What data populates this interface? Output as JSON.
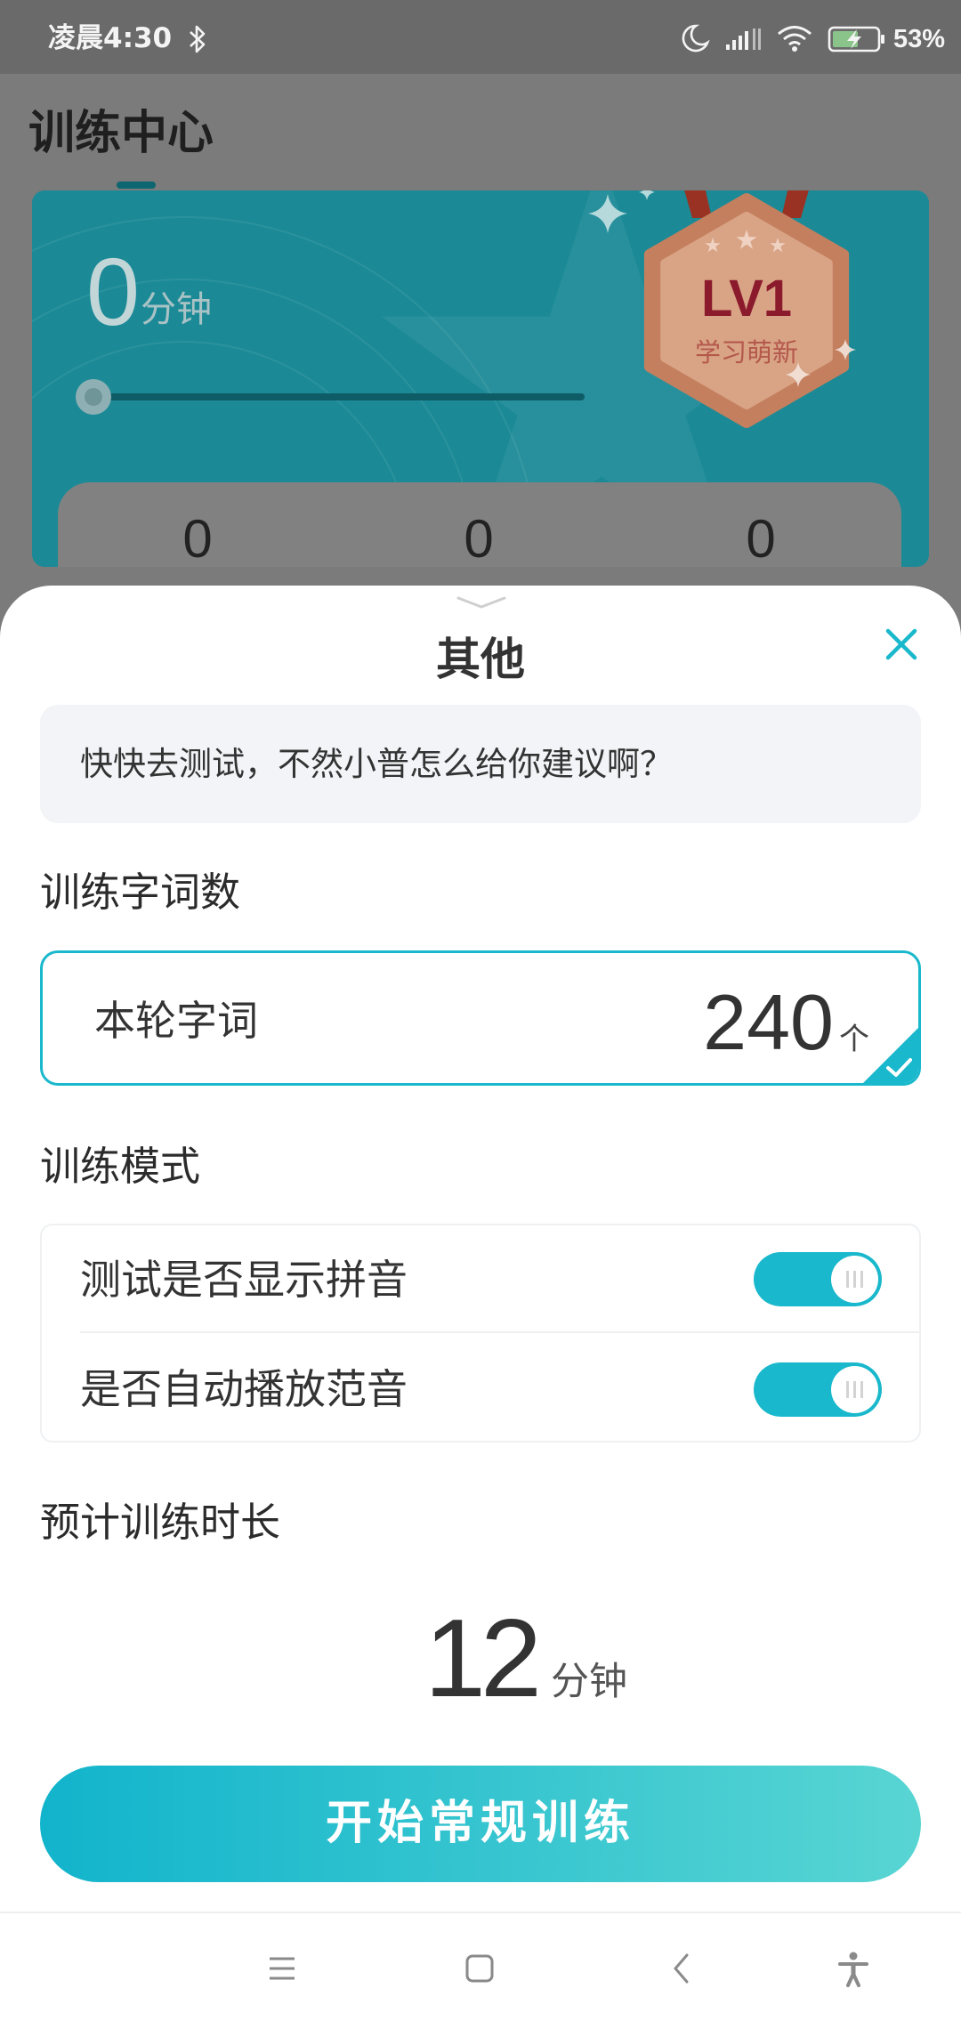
{
  "status_bar": {
    "time": "凌晨4:30",
    "battery_text": "53%",
    "icons": [
      "bluetooth-icon",
      "moon-icon",
      "signal-icon",
      "wifi-icon",
      "battery-charging-icon"
    ]
  },
  "background_page": {
    "title": "训练中心",
    "duration_value": "0",
    "duration_unit": "分钟",
    "progress": 0,
    "badge": {
      "level": "LV1",
      "name": "学习萌新"
    },
    "stats": [
      "0",
      "0",
      "0"
    ]
  },
  "sheet": {
    "title": "其他",
    "hint": "快快去测试，不然小普怎么给你建议啊？",
    "word_count": {
      "label": "训练字词数",
      "option_label": "本轮字词",
      "option_value": "240",
      "option_unit": "个",
      "selected": true
    },
    "mode": {
      "label": "训练模式",
      "toggles": [
        {
          "label": "测试是否显示拼音",
          "on": true
        },
        {
          "label": "是否自动播放范音",
          "on": true
        }
      ]
    },
    "duration": {
      "label": "预计训练时长",
      "value": "12",
      "unit": "分钟"
    },
    "start_button": "开始常规训练"
  },
  "nav_bar": {
    "icons": [
      "menu-icon",
      "home-icon",
      "back-icon",
      "accessibility-icon"
    ]
  },
  "colors": {
    "accent": "#1ab8cc",
    "button_gradient_start": "#12b4cc",
    "button_gradient_end": "#58d5d3",
    "badge_level_text": "#8a1a2c"
  }
}
